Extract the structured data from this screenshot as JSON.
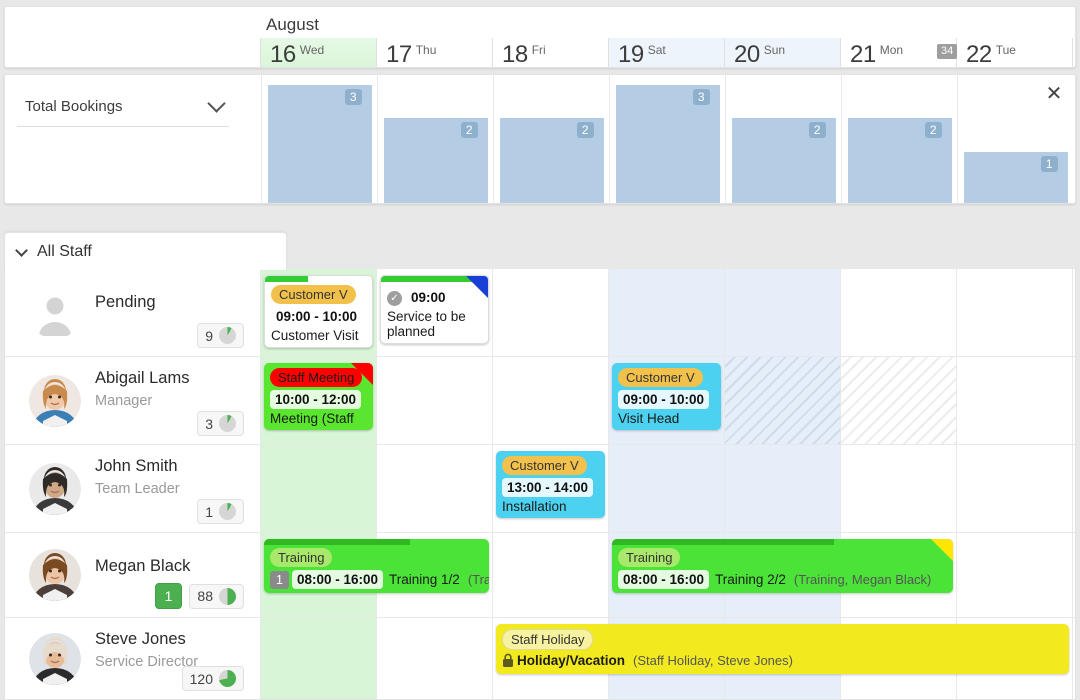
{
  "header": {
    "month": "August",
    "week_number": "34",
    "days": [
      {
        "num": "16",
        "dow": "Wed",
        "state": "today"
      },
      {
        "num": "17",
        "dow": "Thu",
        "state": "normal"
      },
      {
        "num": "18",
        "dow": "Fri",
        "state": "normal"
      },
      {
        "num": "19",
        "dow": "Sat",
        "state": "weekend"
      },
      {
        "num": "20",
        "dow": "Sun",
        "state": "weekend"
      },
      {
        "num": "21",
        "dow": "Mon",
        "state": "normal"
      },
      {
        "num": "22",
        "dow": "Tue",
        "state": "normal"
      }
    ]
  },
  "chart_panel": {
    "select_label": "Total Bookings",
    "chevron_icon": "chevron-down-icon",
    "close_icon": "close-icon"
  },
  "chart_data": {
    "type": "bar",
    "title": "Total Bookings",
    "categories": [
      "16 Wed",
      "17 Thu",
      "18 Fri",
      "19 Sat",
      "20 Sun",
      "21 Mon",
      "22 Tue"
    ],
    "values": [
      3,
      2,
      2,
      3,
      2,
      2,
      1
    ],
    "xlabel": "",
    "ylabel": "",
    "ylim": [
      0,
      3
    ],
    "grid": false,
    "legend": null,
    "bar_color": "#b4cce4",
    "label_color": "#8fb0cc"
  },
  "staff_tab": {
    "label": "All Staff",
    "chevron_icon": "chevron-down-icon"
  },
  "rows": [
    {
      "name": "Pending",
      "role": "",
      "avatar": "placeholder-avatar",
      "count_badge": null,
      "capacity": {
        "value": "9",
        "fill": 8
      }
    },
    {
      "name": "Abigail Lams",
      "role": "Manager",
      "avatar": "photo-avatar",
      "count_badge": null,
      "capacity": {
        "value": "3",
        "fill": 8
      }
    },
    {
      "name": "John Smith",
      "role": "Team Leader",
      "avatar": "photo-avatar",
      "count_badge": null,
      "capacity": {
        "value": "1",
        "fill": 8
      }
    },
    {
      "name": "Megan Black",
      "role": "",
      "avatar": "photo-avatar",
      "count_badge": "1",
      "capacity": {
        "value": "88",
        "fill": 50
      }
    },
    {
      "name": "Steve Jones",
      "role": "Service Director",
      "avatar": "photo-avatar",
      "count_badge": null,
      "capacity": {
        "value": "120",
        "fill": 72
      }
    }
  ],
  "events": [
    {
      "id": "pending-customer-visit",
      "row": 0,
      "col": 0,
      "span": 1,
      "pill": "Customer V",
      "time": "09:00 - 10:00",
      "title": "Customer Visit",
      "sub": "",
      "bg": "#ffffff",
      "topbar": "#33cc33",
      "pill_bg": "#f2c14b",
      "corner": null,
      "seq": null,
      "check": false,
      "lock": false
    },
    {
      "id": "pending-service-to-be-planned",
      "row": 0,
      "col": 1,
      "span": 1,
      "pill": "",
      "time": "09:00",
      "title": "Service to be planned",
      "sub": "",
      "bg": "#ffffff",
      "topbar": "#33cc33",
      "pill_bg": "",
      "corner": "#1a3fd6",
      "seq": null,
      "check": true,
      "lock": false
    },
    {
      "id": "abigail-staff-meeting",
      "row": 1,
      "col": 0,
      "span": 1,
      "pill": "Staff Meeting",
      "time": "10:00 - 12:00",
      "title": "Meeting  (Staff",
      "sub": "",
      "bg": "#5ae62e",
      "topbar": "",
      "pill_bg": "#ff0000",
      "corner": "#ff0000",
      "seq": null,
      "check": false,
      "lock": false
    },
    {
      "id": "abigail-visit-head",
      "row": 1,
      "col": 3,
      "span": 1,
      "pill": "Customer V",
      "time": "09:00 - 10:00",
      "title": "Visit Head",
      "sub": "",
      "bg": "#4cd2f0",
      "topbar": "",
      "pill_bg": "#f2c14b",
      "corner": null,
      "seq": null,
      "check": false,
      "lock": false
    },
    {
      "id": "john-installation",
      "row": 2,
      "col": 2,
      "span": 1,
      "pill": "Customer V",
      "time": "13:00 - 14:00",
      "title": "Installation",
      "sub": "",
      "bg": "#4cd2f0",
      "topbar": "",
      "pill_bg": "#f2c14b",
      "corner": null,
      "seq": null,
      "check": false,
      "lock": false
    },
    {
      "id": "megan-training-1",
      "row": 3,
      "col": 0,
      "span": 2,
      "pill": "Training",
      "time": "08:00 - 16:00",
      "title": "Training 1/2",
      "sub": "(Training, Megan Black)",
      "bg": "#4ce338",
      "topbar": "#2fb81f",
      "pill_bg": "#a8e86b",
      "corner": null,
      "seq": "1",
      "check": false,
      "lock": false
    },
    {
      "id": "megan-training-2",
      "row": 3,
      "col": 3,
      "span": 3,
      "pill": "Training",
      "time": "08:00 - 16:00",
      "title": "Training 2/2",
      "sub": "(Training, Megan Black)",
      "bg": "#4ce338",
      "topbar": "#2fb81f",
      "pill_bg": "#a8e86b",
      "corner": "#ffe600",
      "seq": null,
      "check": false,
      "lock": false
    },
    {
      "id": "steve-staff-holiday",
      "row": 4,
      "col": 2,
      "span": 5,
      "pill": "Staff Holiday",
      "time": "",
      "title": "Holiday/Vacation",
      "sub": "(Staff Holiday, Steve Jones)",
      "bg": "#f2ea1e",
      "topbar": "",
      "pill_bg": "#f7f2a0",
      "corner": null,
      "seq": null,
      "check": false,
      "lock": true
    }
  ]
}
